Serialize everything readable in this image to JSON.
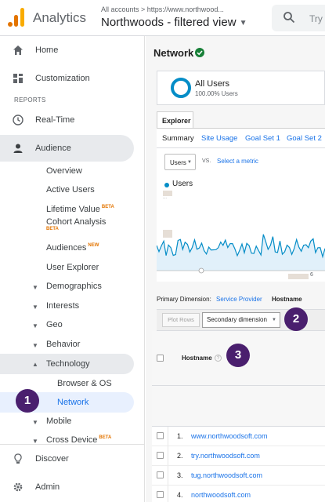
{
  "header": {
    "app_name": "Analytics",
    "breadcrumb": "All accounts > https://www.northwood...",
    "view_name": "Northwoods - filtered view",
    "search_placeholder": "Try"
  },
  "sidebar": {
    "home": "Home",
    "customization": "Customization",
    "reports_header": "REPORTS",
    "realtime": "Real-Time",
    "audience": "Audience",
    "audience_items": {
      "overview": "Overview",
      "active_users": "Active Users",
      "lifetime_value": "Lifetime Value",
      "cohort_analysis": "Cohort Analysis",
      "audiences": "Audiences",
      "user_explorer": "User Explorer",
      "demographics": "Demographics",
      "interests": "Interests",
      "geo": "Geo",
      "behavior": "Behavior",
      "technology": "Technology",
      "browser_os": "Browser & OS",
      "network": "Network",
      "mobile": "Mobile",
      "cross_device": "Cross Device"
    },
    "beta_label": "BETA",
    "new_label": "NEW",
    "discover": "Discover",
    "admin": "Admin"
  },
  "main": {
    "title": "Network",
    "segment": {
      "name": "All Users",
      "pct": "100.00% Users"
    },
    "explorer_tab": "Explorer",
    "subtabs": [
      "Summary",
      "Site Usage",
      "Goal Set 1",
      "Goal Set 2"
    ],
    "metric": "Users",
    "vs": "VS.",
    "select_metric": "Select a metric",
    "legend": "Users",
    "y_label_fragment": "...",
    "x_label_fragment": "6",
    "primary_dimension_label": "Primary Dimension:",
    "primary_dimension_link": "Service Provider",
    "primary_dimension_current": "Hostname",
    "plot_rows": "Plot Rows",
    "secondary_dimension": "Secondary dimension",
    "column_header": "Hostname",
    "help": "?",
    "rows": [
      {
        "num": "1.",
        "host": "www.northwoodsoft.com"
      },
      {
        "num": "2.",
        "host": "try.northwoodsoft.com"
      },
      {
        "num": "3.",
        "host": "tug.northwoodsoft.com"
      },
      {
        "num": "4.",
        "host": "northwoodsoft.com"
      }
    ]
  },
  "callouts": [
    "1",
    "2",
    "3"
  ],
  "colors": {
    "accent": "#058dc7",
    "brand_orange": "#e37400",
    "callout": "#4a1f6e",
    "link": "#1a73e8"
  }
}
